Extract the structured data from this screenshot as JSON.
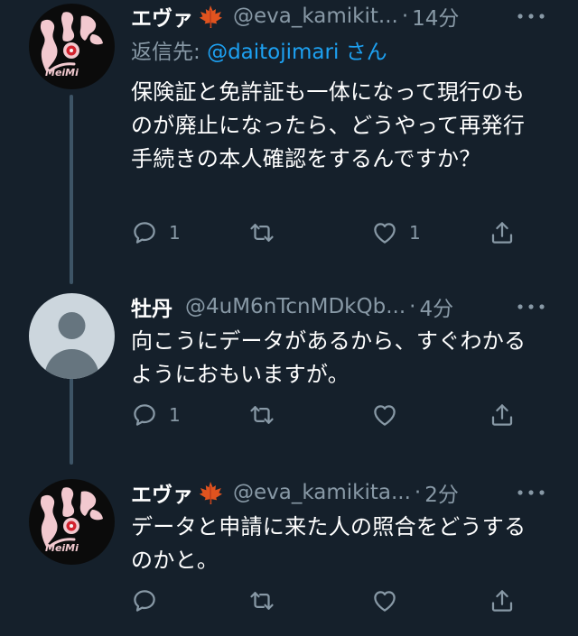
{
  "colors": {
    "background": "#15202b",
    "secondary_text": "#8899a6",
    "mention": "#1da1f2",
    "thread_line": "#3d5466"
  },
  "tweets": [
    {
      "name": "エヴァ",
      "handle": "@eva_kamikit...",
      "dot": "·",
      "time": "14分",
      "reply_to_label": "返信先: ",
      "reply_to_mention": "@daitojimari",
      "reply_to_suffix": " さん",
      "text": "保険証と免許証も一体になって現行のものが廃止になったら、どうやって再発行手続きの本人確認をするんですか？",
      "reply_count": "1",
      "retweet_count": "",
      "like_count": "1"
    },
    {
      "name": "牡丹",
      "handle": "@4uM6nTcnMDkQb...",
      "dot": "·",
      "time": "4分",
      "text": "向こうにデータがあるから、すぐわかるようにおもいますが。",
      "reply_count": "1",
      "retweet_count": "",
      "like_count": ""
    },
    {
      "name": "エヴァ",
      "handle": "@eva_kamikita...",
      "dot": "·",
      "time": "2分",
      "text": "データと申請に来た人の照合をどうするのかと。",
      "reply_count": "",
      "retweet_count": "",
      "like_count": ""
    }
  ],
  "icons": {
    "leaf": "maple-leaf-icon",
    "reply": "reply-icon",
    "retweet": "retweet-icon",
    "like": "heart-icon",
    "share": "share-icon",
    "more": "more-icon"
  },
  "avatar_logo_text": "MeiMi"
}
